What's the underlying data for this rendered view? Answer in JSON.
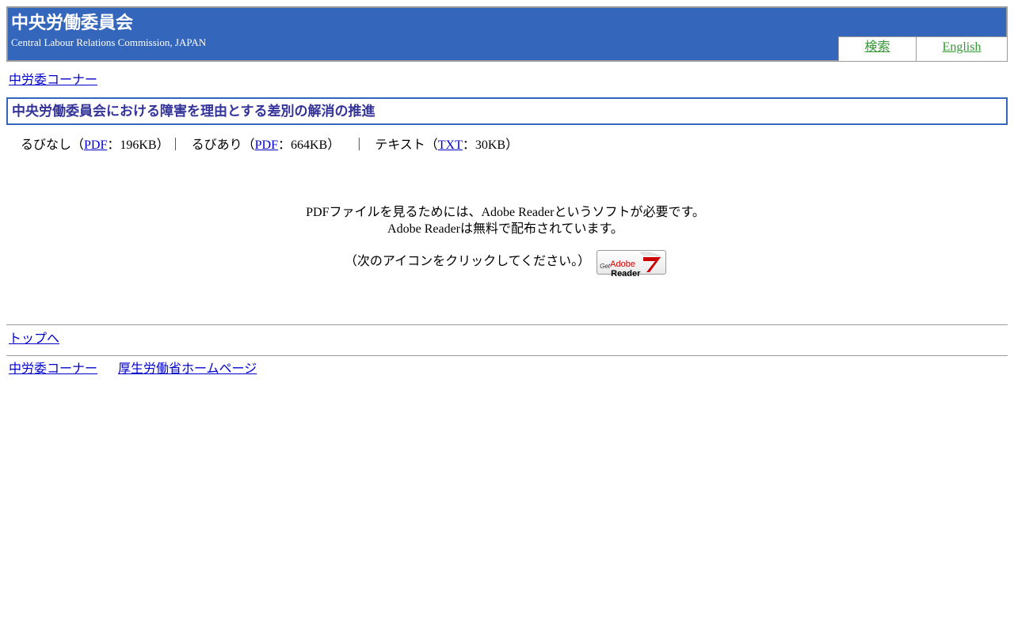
{
  "header": {
    "title": "中央労働委員会",
    "subtitle": "Central Labour Relations Commission, JAPAN",
    "tabs": {
      "search": "検索",
      "english": "English"
    }
  },
  "breadcrumb": {
    "corner": "中労委コーナー"
  },
  "page_title": "中央労働委員会における障害を理由とする差別の解消の推進",
  "downloads": {
    "no_ruby_prefix": "るびなし（",
    "no_ruby_link": "PDF",
    "no_ruby_suffix": "：196KB）｜",
    "ruby_prefix": "るびあり（",
    "ruby_link": "PDF",
    "ruby_suffix": "：664KB）",
    "separator": "｜",
    "text_prefix": "テキスト（",
    "text_link": "TXT",
    "text_suffix": "：30KB）"
  },
  "notice": {
    "line1": "PDFファイルを見るためには、Adobe Readerというソフトが必要です。",
    "line2": "Adobe Readerは無料で配布されています。",
    "instruction": "（次のアイコンをクリックしてください。）",
    "button": {
      "get": "Get",
      "adobe": "Adobe",
      "reader": "Reader"
    }
  },
  "nav": {
    "to_top": "トップへ"
  },
  "footer": {
    "corner": "中労委コーナー",
    "mhlw_home": "厚生労働省ホームページ"
  },
  "colors": {
    "header_bg": "#3466bb",
    "title_text": "#333399",
    "tab_link": "#339933",
    "link": "#0000cc"
  }
}
